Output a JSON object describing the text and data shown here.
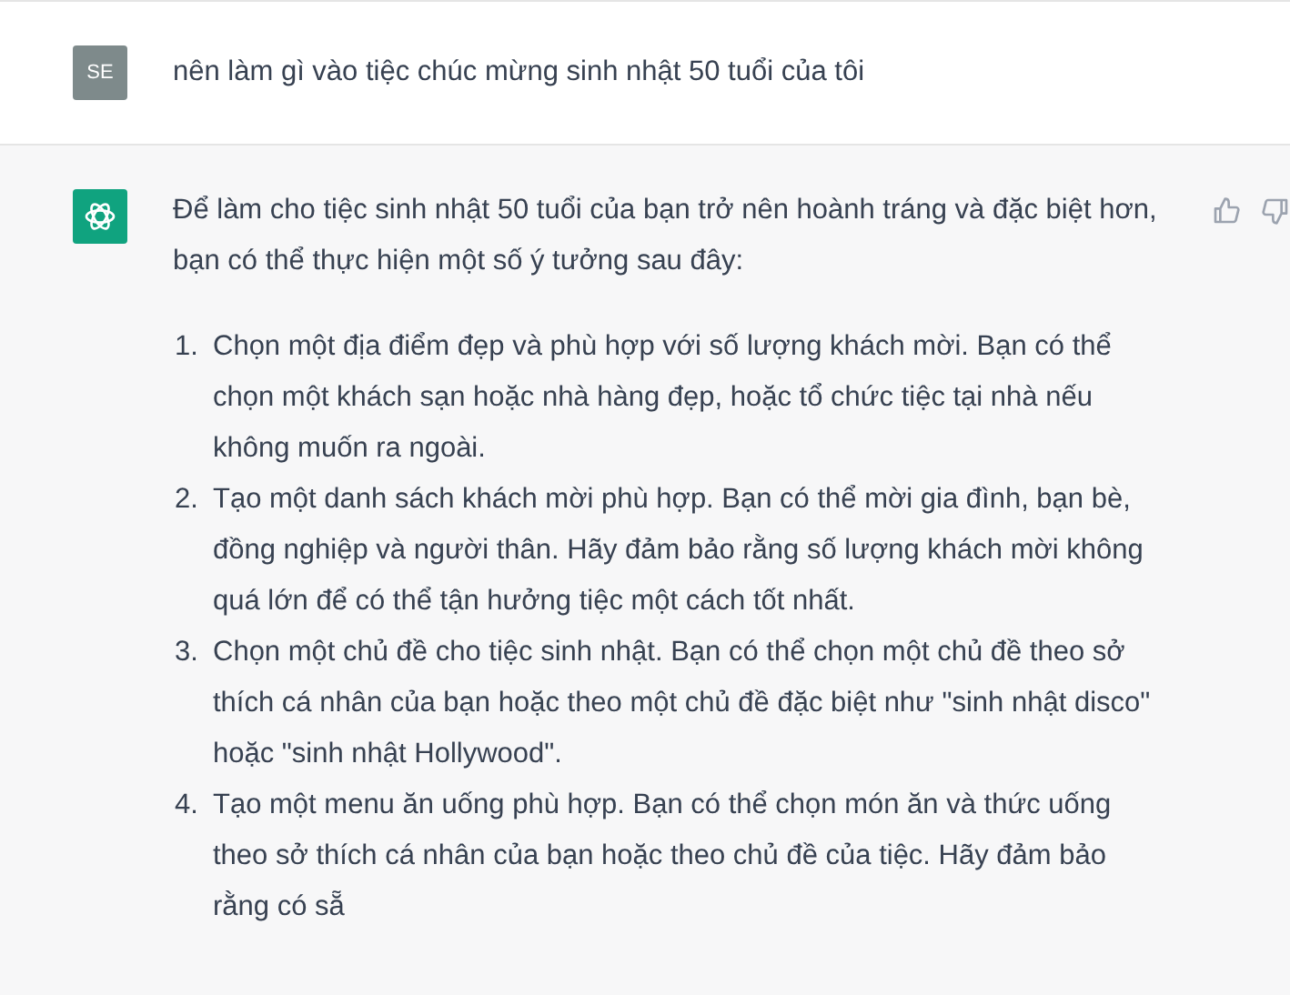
{
  "user_message": {
    "avatar": "SE",
    "text": "nên làm gì vào tiệc chúc mừng sinh nhật 50 tuổi của tôi"
  },
  "assistant_message": {
    "intro": "Để làm cho tiệc sinh nhật 50 tuổi của bạn trở nên hoành tráng và đặc biệt hơn, bạn có thể thực hiện một số ý tưởng sau đây:",
    "items": [
      {
        "number": "1.",
        "text": "Chọn một địa điểm đẹp và phù hợp với số lượng khách mời. Bạn có thể chọn một khách sạn hoặc nhà hàng đẹp, hoặc tổ chức tiệc tại nhà nếu không muốn ra ngoài."
      },
      {
        "number": "2.",
        "text": "Tạo một danh sách khách mời phù hợp. Bạn có thể mời gia đình, bạn bè, đồng nghiệp và người thân. Hãy đảm bảo rằng số lượng khách mời không quá lớn để có thể tận hưởng tiệc một cách tốt nhất."
      },
      {
        "number": "3.",
        "text": "Chọn một chủ đề cho tiệc sinh nhật. Bạn có thể chọn một chủ đề theo sở thích cá nhân của bạn hoặc theo một chủ đề đặc biệt như \"sinh nhật disco\" hoặc \"sinh nhật Hollywood\"."
      },
      {
        "number": "4.",
        "text": "Tạo một menu ăn uống phù hợp. Bạn có thể chọn món ăn và thức uống theo sở thích cá nhân của bạn hoặc theo chủ đề của tiệc. Hãy đảm bảo rằng có sẵ"
      }
    ]
  }
}
